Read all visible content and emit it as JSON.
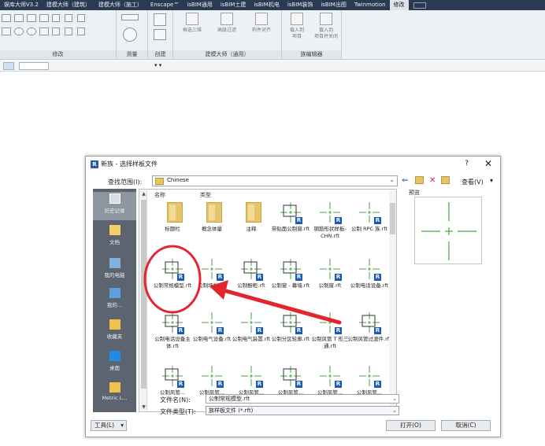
{
  "ribbon": {
    "tabs": [
      "娱库大师V3.2",
      "建模大师（建筑）",
      "建模大师（施工）",
      "Enscape™",
      "isBIM通用",
      "isBIM土建",
      "isBIM机电",
      "isBIM装饰",
      "isBIM出图",
      "Twinmotion",
      "修改"
    ],
    "active_tab": "修改",
    "panels": [
      {
        "title": "修改"
      },
      {
        "title": "测量"
      },
      {
        "title": "创建"
      },
      {
        "title": "建模大师（通用）"
      },
      {
        "title": "族编辑器"
      }
    ],
    "tools": [
      {
        "label1": "框选三维",
        "label2": ""
      },
      {
        "label1": "高级过滤",
        "label2": ""
      },
      {
        "label1": "构件对齐",
        "label2": ""
      },
      {
        "label1": "载入到",
        "label2": "项目"
      },
      {
        "label1": "载入到",
        "label2": "项目并关闭"
      }
    ]
  },
  "dialog": {
    "title": "新族 - 选择样板文件",
    "help": "?",
    "close": "✕",
    "look_in_label": "查找范围(I):",
    "look_in_value": "Chinese",
    "view_label": "查看(V)",
    "places": [
      {
        "label": "历史记录",
        "icon": "history-icon"
      },
      {
        "label": "文档",
        "icon": "documents-icon"
      },
      {
        "label": "我的电脑",
        "icon": "computer-icon"
      },
      {
        "label": "我的...",
        "icon": "network-icon"
      },
      {
        "label": "收藏夹",
        "icon": "favorites-icon"
      },
      {
        "label": "桌面",
        "icon": "desktop-icon"
      },
      {
        "label": "Metric L...",
        "icon": "folder-icon"
      }
    ],
    "columns": {
      "name": "名称",
      "type": "类型"
    },
    "files": [
      {
        "label": "标题栏",
        "kind": "folder"
      },
      {
        "label": "概念体量",
        "kind": "folder"
      },
      {
        "label": "注释",
        "kind": "folder"
      },
      {
        "label": "带贴面公制窗.rft",
        "kind": "rft"
      },
      {
        "label": "钢筋形状样板-CHN.rft",
        "kind": "rft"
      },
      {
        "label": "公制 RPC 族.rft",
        "kind": "rft"
      },
      {
        "label": "公制常规模型.rft",
        "kind": "rft"
      },
      {
        "label": "公制场地.rft",
        "kind": "rft"
      },
      {
        "label": "公制橱柜.rft",
        "kind": "rft"
      },
      {
        "label": "公制窗 - 幕墙.rft",
        "kind": "rft"
      },
      {
        "label": "公制窗.rft",
        "kind": "rft"
      },
      {
        "label": "公制电话设备.rft",
        "kind": "rft"
      },
      {
        "label": "公制电话设备主体.rft",
        "kind": "rft"
      },
      {
        "label": "公制电气设备.rft",
        "kind": "rft"
      },
      {
        "label": "公制电气装置.rft",
        "kind": "rft"
      },
      {
        "label": "公制分区轮廓.rft",
        "kind": "rft"
      },
      {
        "label": "公制风管 T 形三通.rft",
        "kind": "rft"
      },
      {
        "label": "公制风管过渡件.rft",
        "kind": "rft"
      },
      {
        "label": "公制风管...",
        "kind": "rft"
      },
      {
        "label": "公制风管...",
        "kind": "rft"
      },
      {
        "label": "公制风管...",
        "kind": "rft"
      },
      {
        "label": "公制风管...",
        "kind": "rft"
      },
      {
        "label": "公制风管...",
        "kind": "rft"
      },
      {
        "label": "公制风管...",
        "kind": "rft"
      }
    ],
    "file_name_label": "文件名(N):",
    "file_name_value": "公制常规模型.rft",
    "file_type_label": "文件类型(T):",
    "file_type_value": "族样板文件 (*.rft)",
    "preview_label": "预览",
    "tools_button": "工具(L)",
    "open_button": "打开(O)",
    "cancel_button": "取消(C)"
  },
  "colors": {
    "annotation_red": "#e3262d",
    "symbol_green": "#46a646",
    "revit_blue": "#1c5bb5"
  }
}
